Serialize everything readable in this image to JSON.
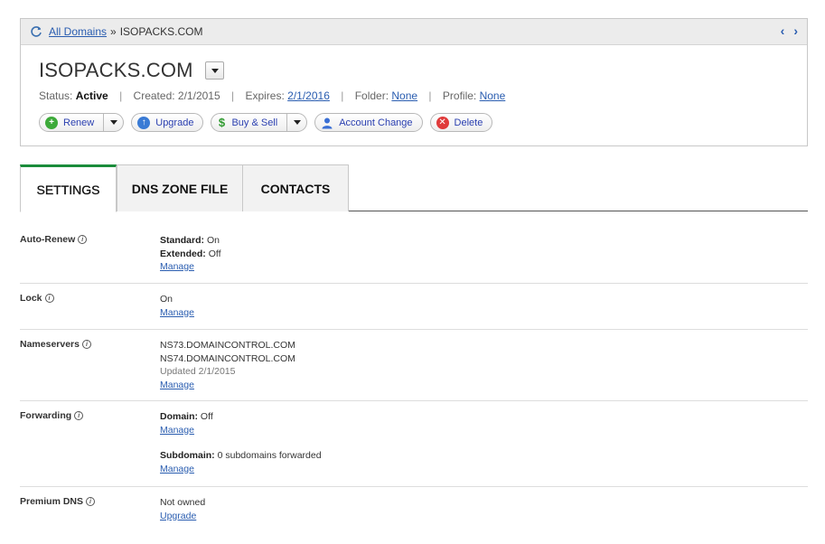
{
  "breadcrumb": {
    "link": "All Domains",
    "separator": "»",
    "current": "ISOPACKS.COM"
  },
  "nav_arrows": {
    "prev": "‹",
    "next": "›"
  },
  "domain": {
    "name": "ISOPACKS.COM",
    "status_label": "Status:",
    "status_value": "Active",
    "created_label": "Created:",
    "created_value": "2/1/2015",
    "expires_label": "Expires:",
    "expires_value": "2/1/2016",
    "folder_label": "Folder:",
    "folder_value": "None",
    "profile_label": "Profile:",
    "profile_value": "None"
  },
  "actions": {
    "renew": "Renew",
    "upgrade": "Upgrade",
    "buy_sell": "Buy & Sell",
    "account_change": "Account Change",
    "delete": "Delete"
  },
  "tabs": [
    "SETTINGS",
    "DNS ZONE FILE",
    "CONTACTS"
  ],
  "settings": {
    "auto_renew": {
      "label": "Auto-Renew",
      "standard_label": "Standard:",
      "standard_value": "On",
      "extended_label": "Extended:",
      "extended_value": "Off",
      "manage": "Manage"
    },
    "lock": {
      "label": "Lock",
      "value": "On",
      "manage": "Manage"
    },
    "nameservers": {
      "label": "Nameservers",
      "ns1": "NS73.DOMAINCONTROL.COM",
      "ns2": "NS74.DOMAINCONTROL.COM",
      "updated": "Updated 2/1/2015",
      "manage": "Manage"
    },
    "forwarding": {
      "label": "Forwarding",
      "domain_label": "Domain:",
      "domain_value": "Off",
      "manage1": "Manage",
      "subdomain_label": "Subdomain:",
      "subdomain_value": "0 subdomains forwarded",
      "manage2": "Manage"
    },
    "premium_dns": {
      "label": "Premium DNS",
      "value": "Not owned",
      "upgrade": "Upgrade"
    }
  },
  "colors": {
    "link": "#2a5db0",
    "active_tab_accent": "#1a8c3a",
    "renew_icon": "#3daa3a",
    "delete_icon": "#e03a3a",
    "upgrade_icon": "#3a7bd5",
    "buy_icon": "#2f9a2f",
    "account_icon": "#3a6fd5"
  }
}
